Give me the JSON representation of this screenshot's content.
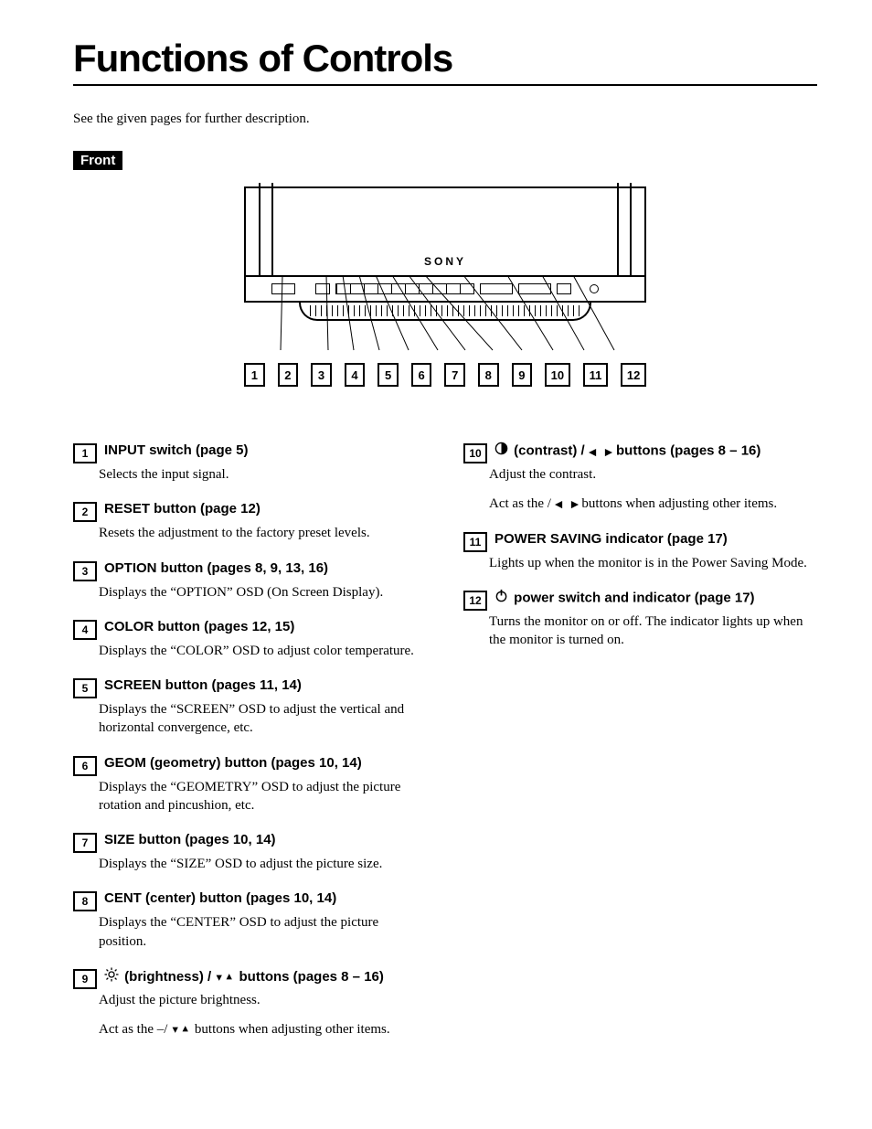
{
  "title": "Functions of Controls",
  "intro": "See the given pages for further description.",
  "front_label": "Front",
  "brand": "SONY",
  "callout_numbers": [
    "1",
    "2",
    "3",
    "4",
    "5",
    "6",
    "7",
    "8",
    "9",
    "10",
    "11",
    "12"
  ],
  "items_left": [
    {
      "num": "1",
      "title": "INPUT switch (page 5)",
      "body": [
        "Selects the input signal."
      ]
    },
    {
      "num": "2",
      "title": "RESET button (page 12)",
      "body": [
        "Resets the adjustment to the factory preset levels."
      ]
    },
    {
      "num": "3",
      "title": "OPTION button (pages 8, 9, 13, 16)",
      "body": [
        "Displays the “OPTION” OSD (On Screen Display)."
      ]
    },
    {
      "num": "4",
      "title": "COLOR button (pages 12, 15)",
      "body": [
        "Displays the “COLOR” OSD to adjust color temperature."
      ]
    },
    {
      "num": "5",
      "title": "SCREEN button (pages 11, 14)",
      "body": [
        "Displays the “SCREEN” OSD to adjust the vertical and horizontal convergence, etc."
      ]
    },
    {
      "num": "6",
      "title": "GEOM (geometry) button (pages 10, 14)",
      "body": [
        "Displays the “GEOMETRY” OSD to adjust the picture rotation and pincushion, etc."
      ]
    },
    {
      "num": "7",
      "title": "SIZE  button (pages 10, 14)",
      "body": [
        "Displays the “SIZE” OSD to adjust the picture size."
      ]
    },
    {
      "num": "8",
      "title": "CENT (center) button (pages 10, 14)",
      "body": [
        "Displays the “CENTER” OSD to adjust the picture position."
      ]
    },
    {
      "num": "9",
      "icon": "brightness",
      "title_after_icon": "(brightness)   /   (↓/↑) buttons (pages  8 – 16)",
      "body": [
        "Adjust the picture brightness.",
        "Act as the –/   (↓/↑) buttons when adjusting other items."
      ],
      "arrows": "updown"
    }
  ],
  "items_right": [
    {
      "num": "10",
      "icon": "contrast",
      "title_after_icon": "(contrast)   /   (←/→) buttons (pages 8 – 16)",
      "body": [
        "Adjust the contrast.",
        "Act as the   /   (←/→) buttons when adjusting other items."
      ],
      "arrows": "leftright"
    },
    {
      "num": "11",
      "title": "POWER SAVING indicator (page 17)",
      "body": [
        "Lights up when the monitor is in the Power Saving Mode."
      ]
    },
    {
      "num": "12",
      "icon": "power",
      "title_after_icon": "power switch and indicator (page 17)",
      "body": [
        "Turns the monitor on or off. The indicator lights up when the monitor is turned on."
      ]
    }
  ]
}
